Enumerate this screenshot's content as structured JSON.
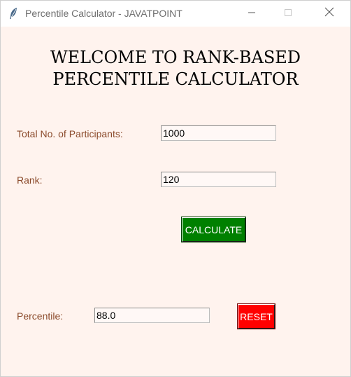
{
  "window": {
    "title": "Percentile Calculator - JAVATPOINT"
  },
  "heading": {
    "line1": "WELCOME TO RANK-BASED",
    "line2": "PERCENTILE CALCULATOR"
  },
  "form": {
    "participants_label": "Total No. of Participants:",
    "participants_value": "1000",
    "rank_label": "Rank:",
    "rank_value": "120",
    "calculate_label": "CALCULATE",
    "percentile_label": "Percentile:",
    "percentile_value": "88.0",
    "reset_label": "RESET"
  },
  "colors": {
    "background": "#fff3ee",
    "label_text": "#8b4a2b",
    "calculate_button": "#008000",
    "reset_button": "#ff0000"
  },
  "icons": {
    "app": "feather-icon",
    "minimize": "minimize-icon",
    "maximize": "maximize-icon",
    "close": "close-icon"
  }
}
